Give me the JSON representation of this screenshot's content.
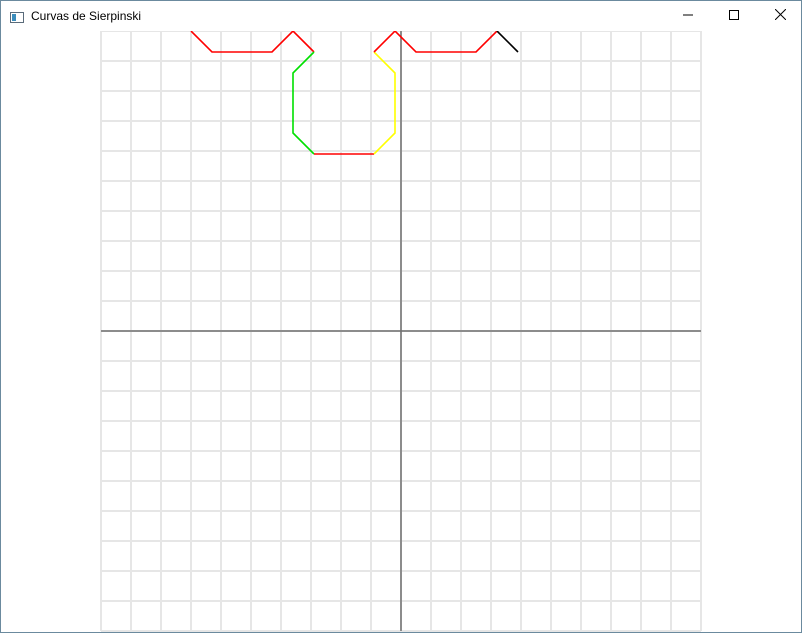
{
  "window": {
    "title": "Curvas de Sierpinski",
    "icon": "app-window-icon",
    "controls": [
      "minimize-icon",
      "maximize-icon",
      "close-icon"
    ]
  },
  "plot": {
    "grid": true,
    "grid_color": "#e6e6e6",
    "axis_color": "#6e6e6e",
    "background": "#ffffff",
    "x_range": [
      -10,
      10
    ],
    "y_range": [
      -10,
      10
    ],
    "segments": [
      {
        "color": "#ff0000",
        "points": [
          [
            -7,
            10
          ],
          [
            -6.3,
            9.3
          ],
          [
            -4.3,
            9.3
          ],
          [
            -3.6,
            10
          ],
          [
            -2.9,
            9.3
          ]
        ]
      },
      {
        "color": "#00e000",
        "points": [
          [
            -2.9,
            9.3
          ],
          [
            -3.6,
            8.6
          ],
          [
            -3.6,
            6.6
          ],
          [
            -2.9,
            5.9
          ]
        ]
      },
      {
        "color": "#ff0000",
        "points": [
          [
            -2.9,
            5.9
          ],
          [
            -0.9,
            5.9
          ]
        ]
      },
      {
        "color": "#ffff00",
        "points": [
          [
            -0.9,
            5.9
          ],
          [
            -0.2,
            6.6
          ],
          [
            -0.2,
            8.6
          ],
          [
            -0.9,
            9.3
          ]
        ]
      },
      {
        "color": "#ff0000",
        "points": [
          [
            -0.9,
            9.3
          ],
          [
            -0.2,
            10
          ],
          [
            0.5,
            9.3
          ],
          [
            2.5,
            9.3
          ],
          [
            3.2,
            10
          ]
        ]
      },
      {
        "color": "#000000",
        "points": [
          [
            3.2,
            10
          ],
          [
            3.9,
            9.3
          ]
        ]
      }
    ]
  }
}
